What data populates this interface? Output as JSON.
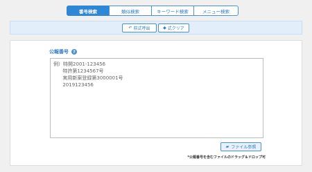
{
  "tabs": [
    {
      "label": "番号検索",
      "active": true
    },
    {
      "label": "類似検索",
      "active": false
    },
    {
      "label": "キーワード検索",
      "active": false
    },
    {
      "label": "メニュー検索",
      "active": false
    }
  ],
  "toolbar": {
    "former_label": "前式呼出",
    "clear_label": "式クリア"
  },
  "main": {
    "field_label": "公報番号",
    "help_icon": "?",
    "placeholder": "例）特開2001-123456\n      特許第1234567号\n      実用新案登録第3000001号\n      2019123456",
    "file_button_label": "ファイル参照",
    "note": "*公報番号を含むファイルのドラッグ＆ドロップ可"
  },
  "colors": {
    "accent": "#2d86d6",
    "toolbar_bg": "#e2eefa",
    "background": "#f0f0f0"
  },
  "icons": {
    "former": "reply-icon",
    "clear": "eraser-icon",
    "file": "folder-open-icon",
    "help": "question-circle-icon"
  }
}
